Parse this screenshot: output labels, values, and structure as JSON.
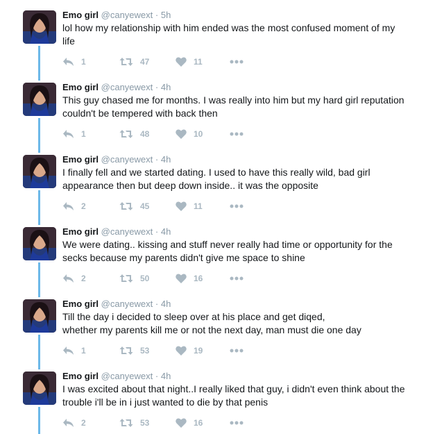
{
  "colors": {
    "thread_line": "#6cb8e8",
    "icon_gray": "#aab8c2",
    "meta_gray": "#8899a6",
    "text": "#14171a"
  },
  "icons": {
    "reply": "reply-arrow-icon",
    "retweet": "retweet-icon",
    "like": "heart-icon",
    "more": "more-dots-icon"
  },
  "tweets": [
    {
      "name": "Emo girl",
      "handle": "@canyewext",
      "dot": "·",
      "time": "5h",
      "lines": [
        "lol how my relationship with him ended was the most confused moment of my",
        "life"
      ],
      "replies": "1",
      "retweets": "47",
      "likes": "11"
    },
    {
      "name": "Emo girl",
      "handle": "@canyewext",
      "dot": "·",
      "time": "4h",
      "lines": [
        "This guy chased me for months. I was really into him but my hard girl reputation",
        "couldn't be tempered with back then"
      ],
      "replies": "1",
      "retweets": "48",
      "likes": "10"
    },
    {
      "name": "Emo girl",
      "handle": "@canyewext",
      "dot": "·",
      "time": "4h",
      "lines": [
        "I finally fell and we started dating. I used to have this really wild, bad girl",
        "appearance then but deep down inside.. it was the opposite"
      ],
      "replies": "2",
      "retweets": "45",
      "likes": "11"
    },
    {
      "name": "Emo girl",
      "handle": "@canyewext",
      "dot": "·",
      "time": "4h",
      "lines": [
        "We were dating.. kissing and stuff never really had time or opportunity for the",
        "secks because my parents didn't give me space to shine"
      ],
      "replies": "2",
      "retweets": "50",
      "likes": "16"
    },
    {
      "name": "Emo girl",
      "handle": "@canyewext",
      "dot": "·",
      "time": "4h",
      "lines": [
        "Till the day i decided to sleep over at his place and get diqed,",
        "whether my parents kill me or not the next day, man must die one day"
      ],
      "replies": "1",
      "retweets": "53",
      "likes": "19"
    },
    {
      "name": "Emo girl",
      "handle": "@canyewext",
      "dot": "·",
      "time": "4h",
      "lines": [
        "I was excited about that night..I really liked that guy, i didn't even think about the",
        "trouble i'll be in i just wanted to die by that penis"
      ],
      "replies": "2",
      "retweets": "53",
      "likes": "16"
    }
  ]
}
